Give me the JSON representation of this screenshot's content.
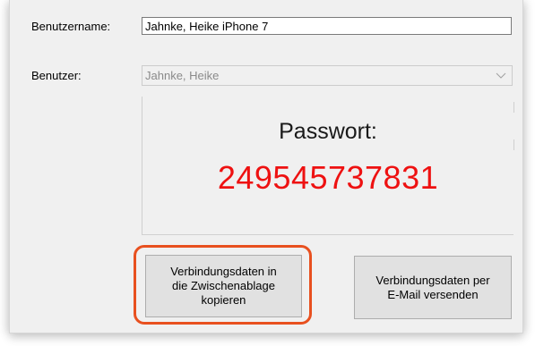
{
  "form": {
    "username_label": "Benutzername:",
    "username_value": "Jahnke, Heike iPhone 7",
    "user_label": "Benutzer:",
    "user_selected": "Jahnke, Heike"
  },
  "password": {
    "title": "Passwort:",
    "value": "249545737831"
  },
  "buttons": {
    "copy": [
      "Verbindungsdaten in",
      "die Zwischenablage",
      "kopieren"
    ],
    "mail": [
      "Verbindungsdaten per",
      "E-Mail versenden"
    ]
  },
  "colors": {
    "password_value": "#ee1111",
    "highlight": "#e8501f"
  },
  "icons": {
    "dropdown": "chevron-down-icon"
  }
}
